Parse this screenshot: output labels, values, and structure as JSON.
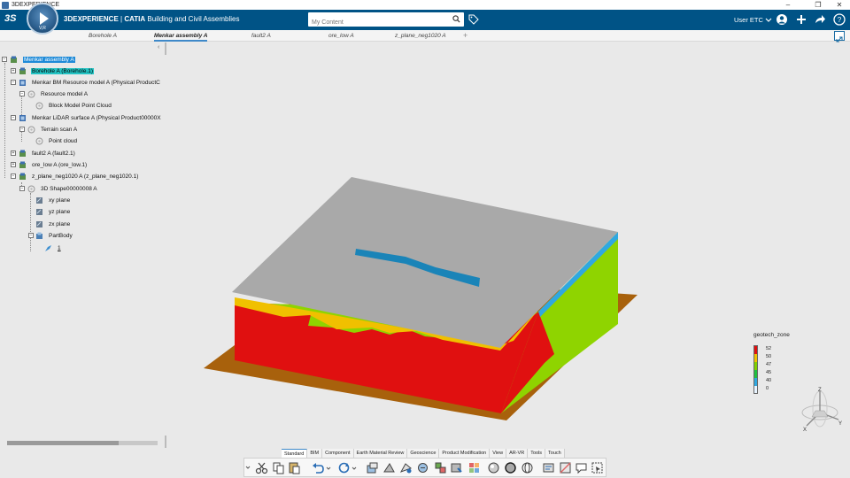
{
  "window": {
    "title": "3DEXPERIENCE",
    "controls": [
      "–",
      "❐",
      "✕"
    ]
  },
  "header": {
    "compass_label": "V,R",
    "brand_prefix": "3DEXPERIENCE",
    "brand_separator": " | ",
    "brand_app": "CATIA",
    "brand_product": " Building and Civil Assemblies",
    "search_placeholder": "My Content",
    "user": "User ETC"
  },
  "tabs": [
    {
      "label": "Borehole A",
      "active": false
    },
    {
      "label": "Menkar assembly A",
      "active": true
    },
    {
      "label": "fault2 A",
      "active": false
    },
    {
      "label": "ore_low A",
      "active": false
    },
    {
      "label": "z_plane_neg1020 A",
      "active": false
    }
  ],
  "tab_add": "+",
  "tree": [
    {
      "label": "Menkar assembly A",
      "state": "selected"
    },
    {
      "label": "Borehole A (Borehole.1)",
      "state": "highlighted"
    },
    {
      "label": "Menkar BM Resource model A (Physical ProductC",
      "state": ""
    },
    {
      "label": "Resource model A",
      "state": ""
    },
    {
      "label": "Block Model Point Cloud",
      "state": ""
    },
    {
      "label": "Menkar LiDAR surface A (Physical Product00000X",
      "state": ""
    },
    {
      "label": "Terrain scan A",
      "state": ""
    },
    {
      "label": "Point cloud",
      "state": ""
    },
    {
      "label": "fault2 A (fault2.1)",
      "state": ""
    },
    {
      "label": "ore_low A (ore_low.1)",
      "state": ""
    },
    {
      "label": "z_plane_neg1020 A (z_plane_neg1020.1)",
      "state": ""
    },
    {
      "label": "3D Shape00000008 A",
      "state": ""
    },
    {
      "label": "xy plane",
      "state": ""
    },
    {
      "label": "yz plane",
      "state": ""
    },
    {
      "label": "zx plane",
      "state": ""
    },
    {
      "label": "PartBody",
      "state": ""
    },
    {
      "label": "1",
      "state": ""
    }
  ],
  "legend": {
    "title": "geotech_zone",
    "entries": [
      {
        "value": "52",
        "color": "#e01010"
      },
      {
        "value": "50",
        "color": "#f0c000"
      },
      {
        "value": "47",
        "color": "#80d000"
      },
      {
        "value": "45",
        "color": "#20c040"
      },
      {
        "value": "40",
        "color": "#30a8e0"
      },
      {
        "value": "0",
        "color": "#e8f4ff"
      }
    ]
  },
  "axes": {
    "x": "X",
    "y": "Y",
    "z": "Z"
  },
  "command_tabs": [
    {
      "label": "Standard",
      "active": true
    },
    {
      "label": "BIM",
      "active": false
    },
    {
      "label": "Component",
      "active": false
    },
    {
      "label": "Earth Material Review",
      "active": false
    },
    {
      "label": "Geoscience",
      "active": false
    },
    {
      "label": "Product Modification",
      "active": false
    },
    {
      "label": "View",
      "active": false
    },
    {
      "label": "AR-VR",
      "active": false
    },
    {
      "label": "Tools",
      "active": false
    },
    {
      "label": "Touch",
      "active": false
    }
  ],
  "colors": {
    "header_bg": "#005386",
    "selection": "#1e8ad8",
    "highlight": "#23c4c4",
    "model_top": "#a9a9a9",
    "model_red": "#e01010",
    "model_green": "#8fd400",
    "terrain_base": "#a8610c",
    "fault_blue": "#1a84b8"
  }
}
